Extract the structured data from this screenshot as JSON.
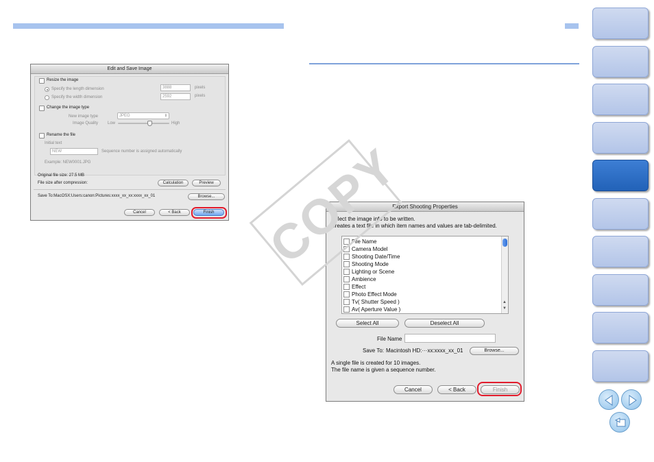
{
  "edit_save_dialog": {
    "title": "Edit and Save Image",
    "resize_label": "Resize the image",
    "specify_length": "Specify the length dimension",
    "specify_width": "Specify the width dimension",
    "length_value": "3888",
    "width_value": "2592",
    "pixels_unit": "pixels",
    "change_type_label": "Change the image type",
    "new_image_type_label": "New image type",
    "image_type_value": "JPEG",
    "image_quality_label": "Image Quality",
    "quality_low": "Low",
    "quality_high": "High",
    "quality_level": 0.62,
    "rename_label": "Rename the file",
    "initial_text_label": "Initial text",
    "initial_text_value": "NEW",
    "sequence_note": "Sequence number is assigned automatically",
    "example_text": "Example:  NEW0001.JPG",
    "original_size": "Original file size: 27.5 MB",
    "size_after": "File size after compression:",
    "calculation_button": "Calculation",
    "preview_button": "Preview",
    "save_to": "Save To:MacOSX:Users:canon:Pictures:xxxx_xx_xx:xxxx_xx_01",
    "browse_button": "Browse...",
    "cancel_button": "Cancel",
    "back_button": "< Back",
    "finish_button": "Finish"
  },
  "export_dialog": {
    "title": "Export Shooting Properties",
    "instruction_1": "Select the image info to be written.",
    "instruction_2": "Creates a text file in which item names and values are tab-delimited.",
    "items": [
      "File Name",
      "Camera Model",
      "Shooting Date/Time",
      "Shooting Mode",
      "Lighting or Scene",
      "Ambience",
      "Effect",
      "Photo Effect Mode",
      "Tv( Shutter Speed )",
      "Av( Aperture Value )"
    ],
    "select_all_button": "Select All",
    "deselect_all_button": "Deselect All",
    "file_name_label": "File Name",
    "file_name_value": "",
    "save_to_label": "Save To:",
    "save_to_value": "Macintosh HD:···xx:xxxx_xx_01",
    "browse_button": "Browse...",
    "note_1": "A single file is created for 10 images.",
    "note_2": "The file name is given a sequence number.",
    "cancel_button": "Cancel",
    "back_button": "< Back",
    "finish_button": "Finish"
  },
  "watermark": "COPY",
  "colors": {
    "accent_bar": "#a7c3ee",
    "highlight_ring": "#e21b2c",
    "nav_tab": "#b3c5e8",
    "nav_tab_active": "#2262b8"
  }
}
